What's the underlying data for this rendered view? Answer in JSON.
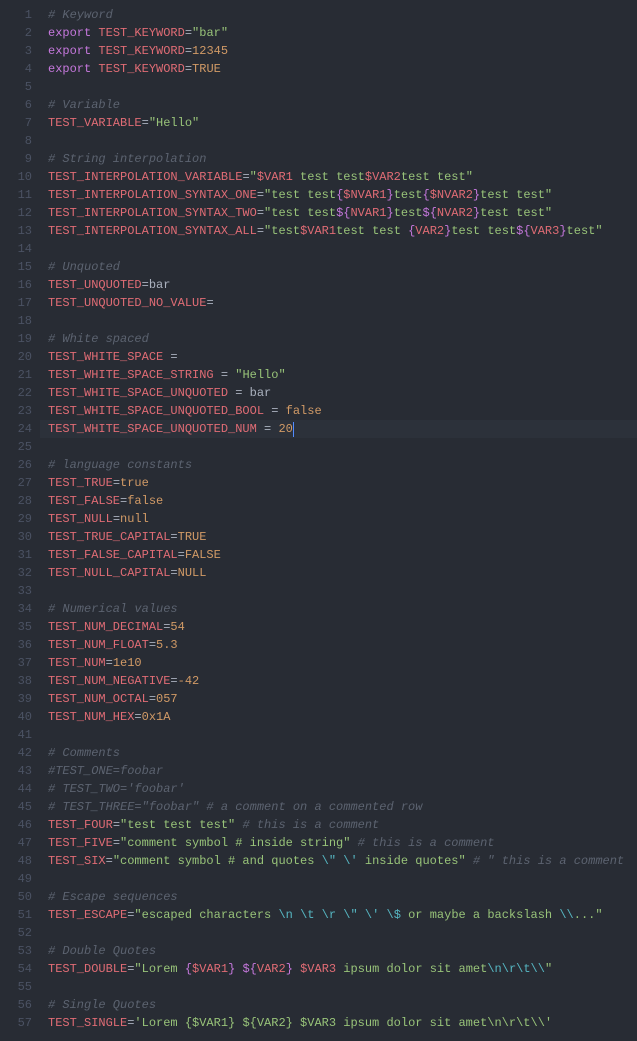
{
  "lineCount": 57,
  "currentLine": 24,
  "lines": [
    [
      {
        "t": "# Keyword",
        "c": "comment"
      }
    ],
    [
      {
        "t": "export",
        "c": "keyword"
      },
      {
        "t": " ",
        "c": "default"
      },
      {
        "t": "TEST_KEYWORD",
        "c": "var"
      },
      {
        "t": "=",
        "c": "punct"
      },
      {
        "t": "\"bar\"",
        "c": "string"
      }
    ],
    [
      {
        "t": "export",
        "c": "keyword"
      },
      {
        "t": " ",
        "c": "default"
      },
      {
        "t": "TEST_KEYWORD",
        "c": "var"
      },
      {
        "t": "=",
        "c": "punct"
      },
      {
        "t": "12345",
        "c": "num"
      }
    ],
    [
      {
        "t": "export",
        "c": "keyword"
      },
      {
        "t": " ",
        "c": "default"
      },
      {
        "t": "TEST_KEYWORD",
        "c": "var"
      },
      {
        "t": "=",
        "c": "punct"
      },
      {
        "t": "TRUE",
        "c": "const"
      }
    ],
    [],
    [
      {
        "t": "# Variable",
        "c": "comment"
      }
    ],
    [
      {
        "t": "TEST_VARIABLE",
        "c": "var"
      },
      {
        "t": "=",
        "c": "punct"
      },
      {
        "t": "\"Hello\"",
        "c": "string"
      }
    ],
    [],
    [
      {
        "t": "# String interpolation",
        "c": "comment"
      }
    ],
    [
      {
        "t": "TEST_INTERPOLATION_VARIABLE",
        "c": "var"
      },
      {
        "t": "=",
        "c": "punct"
      },
      {
        "t": "\"",
        "c": "string"
      },
      {
        "t": "$VAR1",
        "c": "interp"
      },
      {
        "t": " test test",
        "c": "string"
      },
      {
        "t": "$VAR2",
        "c": "interp"
      },
      {
        "t": "test test\"",
        "c": "string"
      }
    ],
    [
      {
        "t": "TEST_INTERPOLATION_SYNTAX_ONE",
        "c": "var"
      },
      {
        "t": "=",
        "c": "punct"
      },
      {
        "t": "\"test test",
        "c": "string"
      },
      {
        "t": "{",
        "c": "brace"
      },
      {
        "t": "$NVAR1",
        "c": "interp"
      },
      {
        "t": "}",
        "c": "brace"
      },
      {
        "t": "test",
        "c": "string"
      },
      {
        "t": "{",
        "c": "brace"
      },
      {
        "t": "$NVAR2",
        "c": "interp"
      },
      {
        "t": "}",
        "c": "brace"
      },
      {
        "t": "test test\"",
        "c": "string"
      }
    ],
    [
      {
        "t": "TEST_INTERPOLATION_SYNTAX_TWO",
        "c": "var"
      },
      {
        "t": "=",
        "c": "punct"
      },
      {
        "t": "\"test test",
        "c": "string"
      },
      {
        "t": "${",
        "c": "brace"
      },
      {
        "t": "NVAR1",
        "c": "interp"
      },
      {
        "t": "}",
        "c": "brace"
      },
      {
        "t": "test",
        "c": "string"
      },
      {
        "t": "${",
        "c": "brace"
      },
      {
        "t": "NVAR2",
        "c": "interp"
      },
      {
        "t": "}",
        "c": "brace"
      },
      {
        "t": "test test\"",
        "c": "string"
      }
    ],
    [
      {
        "t": "TEST_INTERPOLATION_SYNTAX_ALL",
        "c": "var"
      },
      {
        "t": "=",
        "c": "punct"
      },
      {
        "t": "\"test",
        "c": "string"
      },
      {
        "t": "$VAR1",
        "c": "interp"
      },
      {
        "t": "test test ",
        "c": "string"
      },
      {
        "t": "{",
        "c": "brace"
      },
      {
        "t": "VAR2",
        "c": "interp"
      },
      {
        "t": "}",
        "c": "brace"
      },
      {
        "t": "test test",
        "c": "string"
      },
      {
        "t": "${",
        "c": "brace"
      },
      {
        "t": "VAR3",
        "c": "interp"
      },
      {
        "t": "}",
        "c": "brace"
      },
      {
        "t": "test\"",
        "c": "string"
      }
    ],
    [],
    [
      {
        "t": "# Unquoted",
        "c": "comment"
      }
    ],
    [
      {
        "t": "TEST_UNQUOTED",
        "c": "var"
      },
      {
        "t": "=",
        "c": "punct"
      },
      {
        "t": "bar",
        "c": "default"
      }
    ],
    [
      {
        "t": "TEST_UNQUOTED_NO_VALUE",
        "c": "var"
      },
      {
        "t": "=",
        "c": "punct"
      }
    ],
    [],
    [
      {
        "t": "# White spaced",
        "c": "comment"
      }
    ],
    [
      {
        "t": "TEST_WHITE_SPACE",
        "c": "var"
      },
      {
        "t": " ",
        "c": "default"
      },
      {
        "t": "=",
        "c": "punct"
      }
    ],
    [
      {
        "t": "TEST_WHITE_SPACE_STRING",
        "c": "var"
      },
      {
        "t": " ",
        "c": "default"
      },
      {
        "t": "=",
        "c": "punct"
      },
      {
        "t": " ",
        "c": "default"
      },
      {
        "t": "\"Hello\"",
        "c": "string"
      }
    ],
    [
      {
        "t": "TEST_WHITE_SPACE_UNQUOTED",
        "c": "var"
      },
      {
        "t": " ",
        "c": "default"
      },
      {
        "t": "=",
        "c": "punct"
      },
      {
        "t": " bar",
        "c": "default"
      }
    ],
    [
      {
        "t": "TEST_WHITE_SPACE_UNQUOTED_BOOL",
        "c": "var"
      },
      {
        "t": " ",
        "c": "default"
      },
      {
        "t": "=",
        "c": "punct"
      },
      {
        "t": " ",
        "c": "default"
      },
      {
        "t": "false",
        "c": "bool"
      }
    ],
    [
      {
        "t": "TEST_WHITE_SPACE_UNQUOTED_NUM",
        "c": "var"
      },
      {
        "t": " ",
        "c": "default"
      },
      {
        "t": "=",
        "c": "punct"
      },
      {
        "t": " ",
        "c": "default"
      },
      {
        "t": "20",
        "c": "num"
      }
    ],
    [],
    [
      {
        "t": "# language constants",
        "c": "comment"
      }
    ],
    [
      {
        "t": "TEST_TRUE",
        "c": "var"
      },
      {
        "t": "=",
        "c": "punct"
      },
      {
        "t": "true",
        "c": "bool"
      }
    ],
    [
      {
        "t": "TEST_FALSE",
        "c": "var"
      },
      {
        "t": "=",
        "c": "punct"
      },
      {
        "t": "false",
        "c": "bool"
      }
    ],
    [
      {
        "t": "TEST_NULL",
        "c": "var"
      },
      {
        "t": "=",
        "c": "punct"
      },
      {
        "t": "null",
        "c": "bool"
      }
    ],
    [
      {
        "t": "TEST_TRUE_CAPITAL",
        "c": "var"
      },
      {
        "t": "=",
        "c": "punct"
      },
      {
        "t": "TRUE",
        "c": "const"
      }
    ],
    [
      {
        "t": "TEST_FALSE_CAPITAL",
        "c": "var"
      },
      {
        "t": "=",
        "c": "punct"
      },
      {
        "t": "FALSE",
        "c": "const"
      }
    ],
    [
      {
        "t": "TEST_NULL_CAPITAL",
        "c": "var"
      },
      {
        "t": "=",
        "c": "punct"
      },
      {
        "t": "NULL",
        "c": "const"
      }
    ],
    [],
    [
      {
        "t": "# Numerical values",
        "c": "comment"
      }
    ],
    [
      {
        "t": "TEST_NUM_DECIMAL",
        "c": "var"
      },
      {
        "t": "=",
        "c": "punct"
      },
      {
        "t": "54",
        "c": "num"
      }
    ],
    [
      {
        "t": "TEST_NUM_FLOAT",
        "c": "var"
      },
      {
        "t": "=",
        "c": "punct"
      },
      {
        "t": "5.3",
        "c": "num"
      }
    ],
    [
      {
        "t": "TEST_NUM",
        "c": "var"
      },
      {
        "t": "=",
        "c": "punct"
      },
      {
        "t": "1e10",
        "c": "num"
      }
    ],
    [
      {
        "t": "TEST_NUM_NEGATIVE",
        "c": "var"
      },
      {
        "t": "=",
        "c": "punct"
      },
      {
        "t": "-42",
        "c": "num"
      }
    ],
    [
      {
        "t": "TEST_NUM_OCTAL",
        "c": "var"
      },
      {
        "t": "=",
        "c": "punct"
      },
      {
        "t": "057",
        "c": "num"
      }
    ],
    [
      {
        "t": "TEST_NUM_HEX",
        "c": "var"
      },
      {
        "t": "=",
        "c": "punct"
      },
      {
        "t": "0x1A",
        "c": "num"
      }
    ],
    [],
    [
      {
        "t": "# Comments",
        "c": "comment"
      }
    ],
    [
      {
        "t": "#TEST_ONE=foobar",
        "c": "comment"
      }
    ],
    [
      {
        "t": "# TEST_TWO='foobar'",
        "c": "comment"
      }
    ],
    [
      {
        "t": "# TEST_THREE=\"foobar\" # a comment on a commented row",
        "c": "comment"
      }
    ],
    [
      {
        "t": "TEST_FOUR",
        "c": "var"
      },
      {
        "t": "=",
        "c": "punct"
      },
      {
        "t": "\"test test test\"",
        "c": "string"
      },
      {
        "t": " ",
        "c": "default"
      },
      {
        "t": "# this is a comment",
        "c": "comment"
      }
    ],
    [
      {
        "t": "TEST_FIVE",
        "c": "var"
      },
      {
        "t": "=",
        "c": "punct"
      },
      {
        "t": "\"comment symbol # inside string\"",
        "c": "string"
      },
      {
        "t": " ",
        "c": "default"
      },
      {
        "t": "# this is a comment",
        "c": "comment"
      }
    ],
    [
      {
        "t": "TEST_SIX",
        "c": "var"
      },
      {
        "t": "=",
        "c": "punct"
      },
      {
        "t": "\"comment symbol # and quotes ",
        "c": "string"
      },
      {
        "t": "\\\"",
        "c": "escape"
      },
      {
        "t": " ",
        "c": "string"
      },
      {
        "t": "\\'",
        "c": "escape"
      },
      {
        "t": " inside quotes\"",
        "c": "string"
      },
      {
        "t": " ",
        "c": "default"
      },
      {
        "t": "# \" this is a comment",
        "c": "comment"
      }
    ],
    [],
    [
      {
        "t": "# Escape sequences",
        "c": "comment"
      }
    ],
    [
      {
        "t": "TEST_ESCAPE",
        "c": "var"
      },
      {
        "t": "=",
        "c": "punct"
      },
      {
        "t": "\"escaped characters ",
        "c": "string"
      },
      {
        "t": "\\n",
        "c": "escape"
      },
      {
        "t": " ",
        "c": "string"
      },
      {
        "t": "\\t",
        "c": "escape"
      },
      {
        "t": " ",
        "c": "string"
      },
      {
        "t": "\\r",
        "c": "escape"
      },
      {
        "t": " ",
        "c": "string"
      },
      {
        "t": "\\\"",
        "c": "escape"
      },
      {
        "t": " ",
        "c": "string"
      },
      {
        "t": "\\'",
        "c": "escape"
      },
      {
        "t": " ",
        "c": "string"
      },
      {
        "t": "\\$",
        "c": "escape"
      },
      {
        "t": " or maybe a backslash ",
        "c": "string"
      },
      {
        "t": "\\\\",
        "c": "escape"
      },
      {
        "t": "...\"",
        "c": "string"
      }
    ],
    [],
    [
      {
        "t": "# Double Quotes",
        "c": "comment"
      }
    ],
    [
      {
        "t": "TEST_DOUBLE",
        "c": "var"
      },
      {
        "t": "=",
        "c": "punct"
      },
      {
        "t": "\"Lorem ",
        "c": "string"
      },
      {
        "t": "{",
        "c": "brace"
      },
      {
        "t": "$VAR1",
        "c": "interp"
      },
      {
        "t": "}",
        "c": "brace"
      },
      {
        "t": " ",
        "c": "string"
      },
      {
        "t": "${",
        "c": "brace"
      },
      {
        "t": "VAR2",
        "c": "interp"
      },
      {
        "t": "}",
        "c": "brace"
      },
      {
        "t": " ",
        "c": "string"
      },
      {
        "t": "$VAR3",
        "c": "interp"
      },
      {
        "t": " ipsum dolor sit amet",
        "c": "string"
      },
      {
        "t": "\\n\\r\\t\\\\",
        "c": "escape"
      },
      {
        "t": "\"",
        "c": "string"
      }
    ],
    [],
    [
      {
        "t": "# Single Quotes",
        "c": "comment"
      }
    ],
    [
      {
        "t": "TEST_SINGLE",
        "c": "var"
      },
      {
        "t": "=",
        "c": "punct"
      },
      {
        "t": "'Lorem {$VAR1} ${VAR2} $VAR3 ipsum dolor sit amet\\n\\r\\t\\\\'",
        "c": "string"
      }
    ]
  ]
}
